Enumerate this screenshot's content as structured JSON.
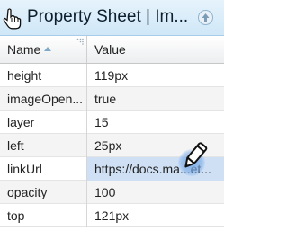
{
  "panel": {
    "title": "Property Sheet | Im...",
    "icon": "hand-pointer-icon",
    "collapse_icon": "collapse-up-icon"
  },
  "grid": {
    "columns": {
      "name": "Name",
      "value": "Value"
    },
    "rows": [
      {
        "name": "height",
        "value": "119px"
      },
      {
        "name": "imageOpen...",
        "value": "true"
      },
      {
        "name": "layer",
        "value": "15"
      },
      {
        "name": "left",
        "value": "25px"
      },
      {
        "name": "linkUrl",
        "value": "https://docs.ma...et..."
      },
      {
        "name": "opacity",
        "value": "100"
      },
      {
        "name": "top",
        "value": "121px"
      }
    ]
  },
  "colors": {
    "titlebar": "#cfe7f7",
    "selected_cell": "#cfe0f5",
    "cursor_halo": "#78aae6"
  },
  "cursor": {
    "icon": "pencil-edit-icon"
  }
}
